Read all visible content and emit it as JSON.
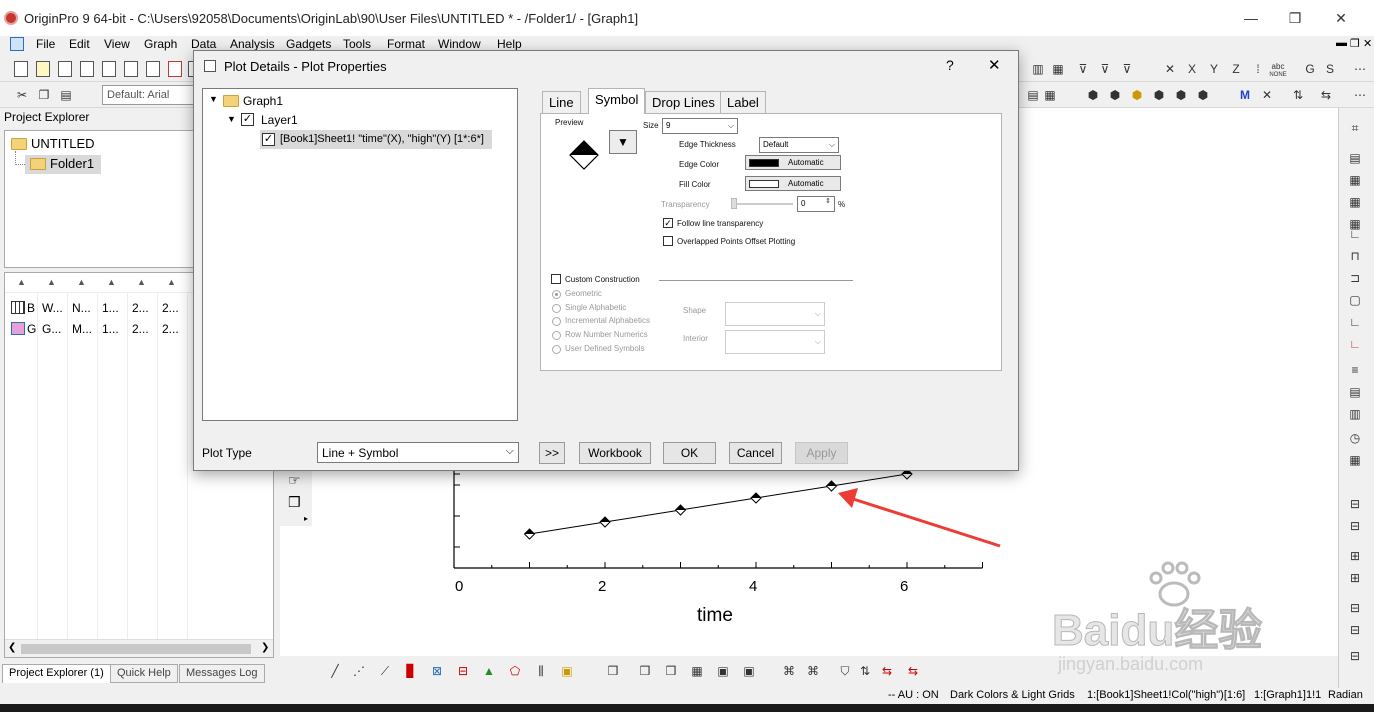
{
  "window": {
    "title": "OriginPro 9 64-bit - C:\\Users\\92058\\Documents\\OriginLab\\90\\User Files\\UNTITLED * - /Folder1/ - [Graph1]",
    "minimize": "—",
    "restore": "❐",
    "close": "✕"
  },
  "menu": [
    "File",
    "Edit",
    "View",
    "Graph",
    "Data",
    "Analysis",
    "Gadgets",
    "Tools",
    "Format",
    "Window",
    "Help"
  ],
  "toolbar": {
    "font_combo": "Default: Arial",
    "axis_letters": [
      "X",
      "Y",
      "Z"
    ],
    "abc_label": "abc",
    "none_label": "NONE",
    "g_label": "G",
    "s_label": "S"
  },
  "project_explorer": {
    "title": "Project Explorer",
    "root": "UNTITLED",
    "folder": "Folder1",
    "list_rows": [
      [
        "B",
        "W...",
        "N...",
        "1...",
        "2...",
        "2..."
      ],
      [
        "G",
        "G...",
        "M...",
        "1...",
        "2...",
        "2..."
      ]
    ],
    "tabs": [
      "Project Explorer (1)",
      "Quick Help",
      "Messages Log"
    ]
  },
  "dialog": {
    "title": "Plot Details - Plot Properties",
    "help": "?",
    "close": "✕",
    "tree": {
      "graph": "Graph1",
      "layer": "Layer1",
      "plot": "[Book1]Sheet1! \"time\"(X), \"high\"(Y) [1*:6*]"
    },
    "tabs": [
      "Line",
      "Symbol",
      "Drop Lines",
      "Label"
    ],
    "symbol": {
      "preview_label": "Preview",
      "size_label": "Size",
      "size_value": "9",
      "edge_thickness_label": "Edge Thickness",
      "edge_thickness_value": "Default",
      "edge_color_label": "Edge Color",
      "edge_color_value": "Automatic",
      "edge_color_hex": "#000000",
      "fill_color_label": "Fill Color",
      "fill_color_value": "Automatic",
      "fill_color_hex": "#ffffff",
      "transparency_label": "Transparency",
      "transparency_value": "0",
      "percent": "%",
      "follow_line_transparency": "Follow line transparency",
      "overlapped_points": "Overlapped Points Offset Plotting",
      "custom_construction": "Custom Construction",
      "geometric": "Geometric",
      "single_alphabetic": "Single Alphabetic",
      "incremental_alphabetics": "Incremental Alphabetics",
      "row_number_numerics": "Row Number Numerics",
      "user_defined_symbols": "User Defined Symbols",
      "shape_label": "Shape",
      "interior_label": "Interior"
    },
    "plot_type_label": "Plot Type",
    "plot_type_value": "Line + Symbol",
    "buttons": {
      "expand": ">>",
      "workbook": "Workbook",
      "ok": "OK",
      "cancel": "Cancel",
      "apply": "Apply"
    }
  },
  "graph": {
    "xlabel": "time",
    "xticks": [
      "0",
      "2",
      "4",
      "6"
    ]
  },
  "chart_data": {
    "type": "line",
    "x": [
      1,
      2,
      3,
      4,
      5,
      6
    ],
    "y": [
      1,
      2,
      3,
      4,
      5,
      6
    ],
    "xlabel": "time",
    "xlim": [
      0,
      7
    ],
    "marker": "diamond",
    "grid": false
  },
  "statusbar": {
    "items": [
      "-- AU : ON",
      "Dark Colors & Light Grids",
      "1:[Book1]Sheet1!Col(\"high\")[1:6]",
      "1:[Graph1]1!1",
      "Radian"
    ]
  },
  "watermark": {
    "brand": "Baidu经验",
    "url": "jingyan.baidu.com"
  }
}
